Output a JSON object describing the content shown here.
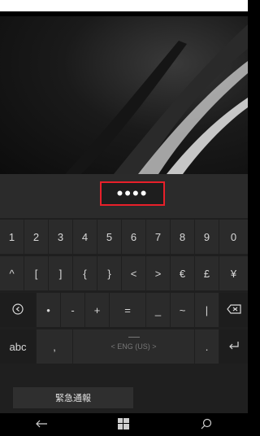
{
  "password": {
    "masked": "••••"
  },
  "keyboard": {
    "row1": [
      "1",
      "2",
      "3",
      "4",
      "5",
      "6",
      "7",
      "8",
      "9",
      "0"
    ],
    "row2": [
      "^",
      "[",
      "]",
      "{",
      "}",
      "<",
      ">",
      "€",
      "£",
      "¥"
    ],
    "row3": {
      "settings_icon": "settings-icon",
      "keys": [
        "•",
        "-",
        "+",
        "=",
        "_",
        "~",
        "|"
      ],
      "backspace_icon": "backspace-icon"
    },
    "row4": {
      "abc": "abc",
      "comma": ",",
      "language": "< ENG (US) >",
      "period": ".",
      "enter_icon": "enter-icon"
    }
  },
  "emergency_button": "緊急通報",
  "navbar": {
    "back_icon": "back-arrow-icon",
    "start_icon": "windows-logo-icon",
    "search_icon": "search-icon"
  }
}
